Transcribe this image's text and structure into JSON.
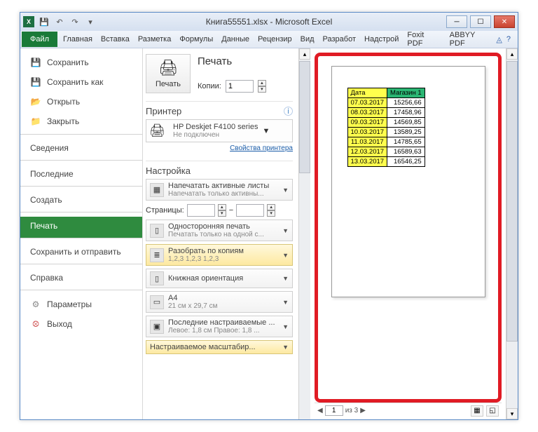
{
  "window": {
    "title": "Книга55551.xlsx - Microsoft Excel"
  },
  "ribbon": {
    "file": "Файл",
    "tabs": [
      "Главная",
      "Вставка",
      "Разметка",
      "Формулы",
      "Данные",
      "Рецензир",
      "Вид",
      "Разработ",
      "Надстрой",
      "Foxit PDF",
      "ABBYY PDF"
    ]
  },
  "sidebar": {
    "save": "Сохранить",
    "save_as": "Сохранить как",
    "open": "Открыть",
    "close": "Закрыть",
    "info": "Сведения",
    "recent": "Последние",
    "new": "Создать",
    "print": "Печать",
    "share": "Сохранить и отправить",
    "help": "Справка",
    "options": "Параметры",
    "exit": "Выход"
  },
  "print": {
    "heading": "Печать",
    "print_btn": "Печать",
    "copies_label": "Копии:",
    "copies_value": "1",
    "printer_heading": "Принтер",
    "printer_name": "HP Deskjet F4100 series",
    "printer_status": "Не подключен",
    "printer_props": "Свойства принтера",
    "settings_heading": "Настройка",
    "active_sheets_t": "Напечатать активные листы",
    "active_sheets_s": "Напечатать только активны...",
    "pages_label": "Страницы:",
    "pages_sep": "−",
    "one_side_t": "Односторонняя печать",
    "one_side_s": "Печатать только на одной с...",
    "collate_t": "Разобрать по копиям",
    "collate_s": "1,2,3   1,2,3   1,2,3",
    "orient_t": "Книжная ориентация",
    "paper_t": "A4",
    "paper_s": "21 см x 29,7 см",
    "margins_t": "Последние настраиваемые ...",
    "margins_s": "Левое: 1,8 см   Правое: 1,8 ...",
    "scale_t": "Настраиваемое масштабир..."
  },
  "preview": {
    "page_field": "1",
    "page_of": "из 3",
    "headers": {
      "date": "Дата",
      "store": "Магазин 1"
    },
    "rows": [
      {
        "d": "07.03.2017",
        "v": "15256,66"
      },
      {
        "d": "08.03.2017",
        "v": "17458,96"
      },
      {
        "d": "09.03.2017",
        "v": "14569,85"
      },
      {
        "d": "10.03.2017",
        "v": "13589,25"
      },
      {
        "d": "11.03.2017",
        "v": "14785,65"
      },
      {
        "d": "12.03.2017",
        "v": "16589,63"
      },
      {
        "d": "13.03.2017",
        "v": "16546,25"
      }
    ]
  },
  "chart_data": {
    "type": "table",
    "title": "",
    "columns": [
      "Дата",
      "Магазин 1"
    ],
    "rows": [
      [
        "07.03.2017",
        15256.66
      ],
      [
        "08.03.2017",
        17458.96
      ],
      [
        "09.03.2017",
        14569.85
      ],
      [
        "10.03.2017",
        13589.25
      ],
      [
        "11.03.2017",
        14785.65
      ],
      [
        "12.03.2017",
        16589.63
      ],
      [
        "13.03.2017",
        16546.25
      ]
    ]
  }
}
